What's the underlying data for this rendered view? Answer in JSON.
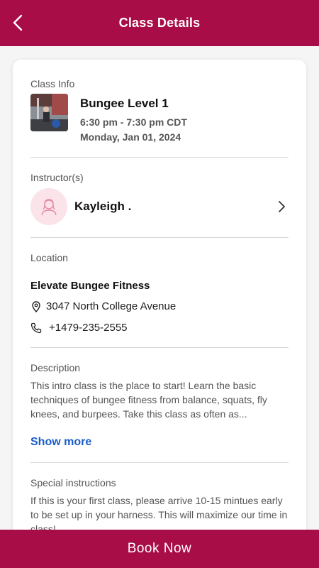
{
  "header": {
    "title": "Class Details"
  },
  "class_info": {
    "label": "Class Info",
    "name": "Bungee Level 1",
    "time": "6:30 pm - 7:30 pm CDT",
    "date": "Monday, Jan 01, 2024"
  },
  "instructor": {
    "label": "Instructor(s)",
    "name": "Kayleigh ."
  },
  "location": {
    "label": "Location",
    "name": "Elevate Bungee Fitness",
    "address": "3047 North College Avenue",
    "phone": "+1479-235-2555"
  },
  "description": {
    "label": "Description",
    "text": "This intro class is the place to start! Learn the basic techniques of bungee fitness from balance, squats, fly knees, and burpees. Take this class as often as...",
    "show_more": "Show more"
  },
  "special_instructions": {
    "label": "Special instructions",
    "text": "If this is your first class, please arrive 10-15 mintues early to be set up in your harness. This will maximize our time in class!"
  },
  "footer": {
    "book_label": "Book Now"
  },
  "colors": {
    "brand": "#a90d47",
    "link": "#1a5dc9",
    "avatar_bg": "#fbe3ea"
  }
}
